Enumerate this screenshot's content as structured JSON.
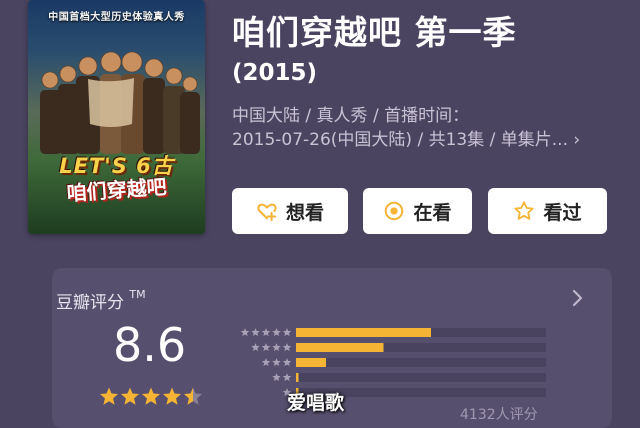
{
  "poster": {
    "tagline": "中国首档大型历史体验真人秀",
    "logo_line1": "LET'S 6古",
    "logo_line2": "咱们穿越吧"
  },
  "movie": {
    "title": "咱们穿越吧 第一季",
    "year": "(2015)",
    "meta_line1": "中国大陆 / 真人秀 / 首播时间：",
    "meta_line2": "2015-07-26(中国大陆) / 共13集 / 单集片...",
    "meta_more": "›"
  },
  "actions": {
    "want": "想看",
    "watching": "在看",
    "watched": "看过"
  },
  "rating": {
    "label": "豆瓣评分",
    "tm": "TM",
    "score": "8.6",
    "stars": 4.5,
    "distribution": [
      0.54,
      0.35,
      0.12,
      0.01,
      0.01
    ],
    "count_text": "4132人评分"
  },
  "watermark": "爱唱歌",
  "colors": {
    "background": "#4b4460",
    "card": "#574f6e",
    "accent": "#f5b433",
    "track": "#4a4360"
  },
  "icons": {
    "want": "heart-plus-icon",
    "watching": "target-icon",
    "watched": "star-outline-icon",
    "rating_more": "chevron-right-icon"
  }
}
